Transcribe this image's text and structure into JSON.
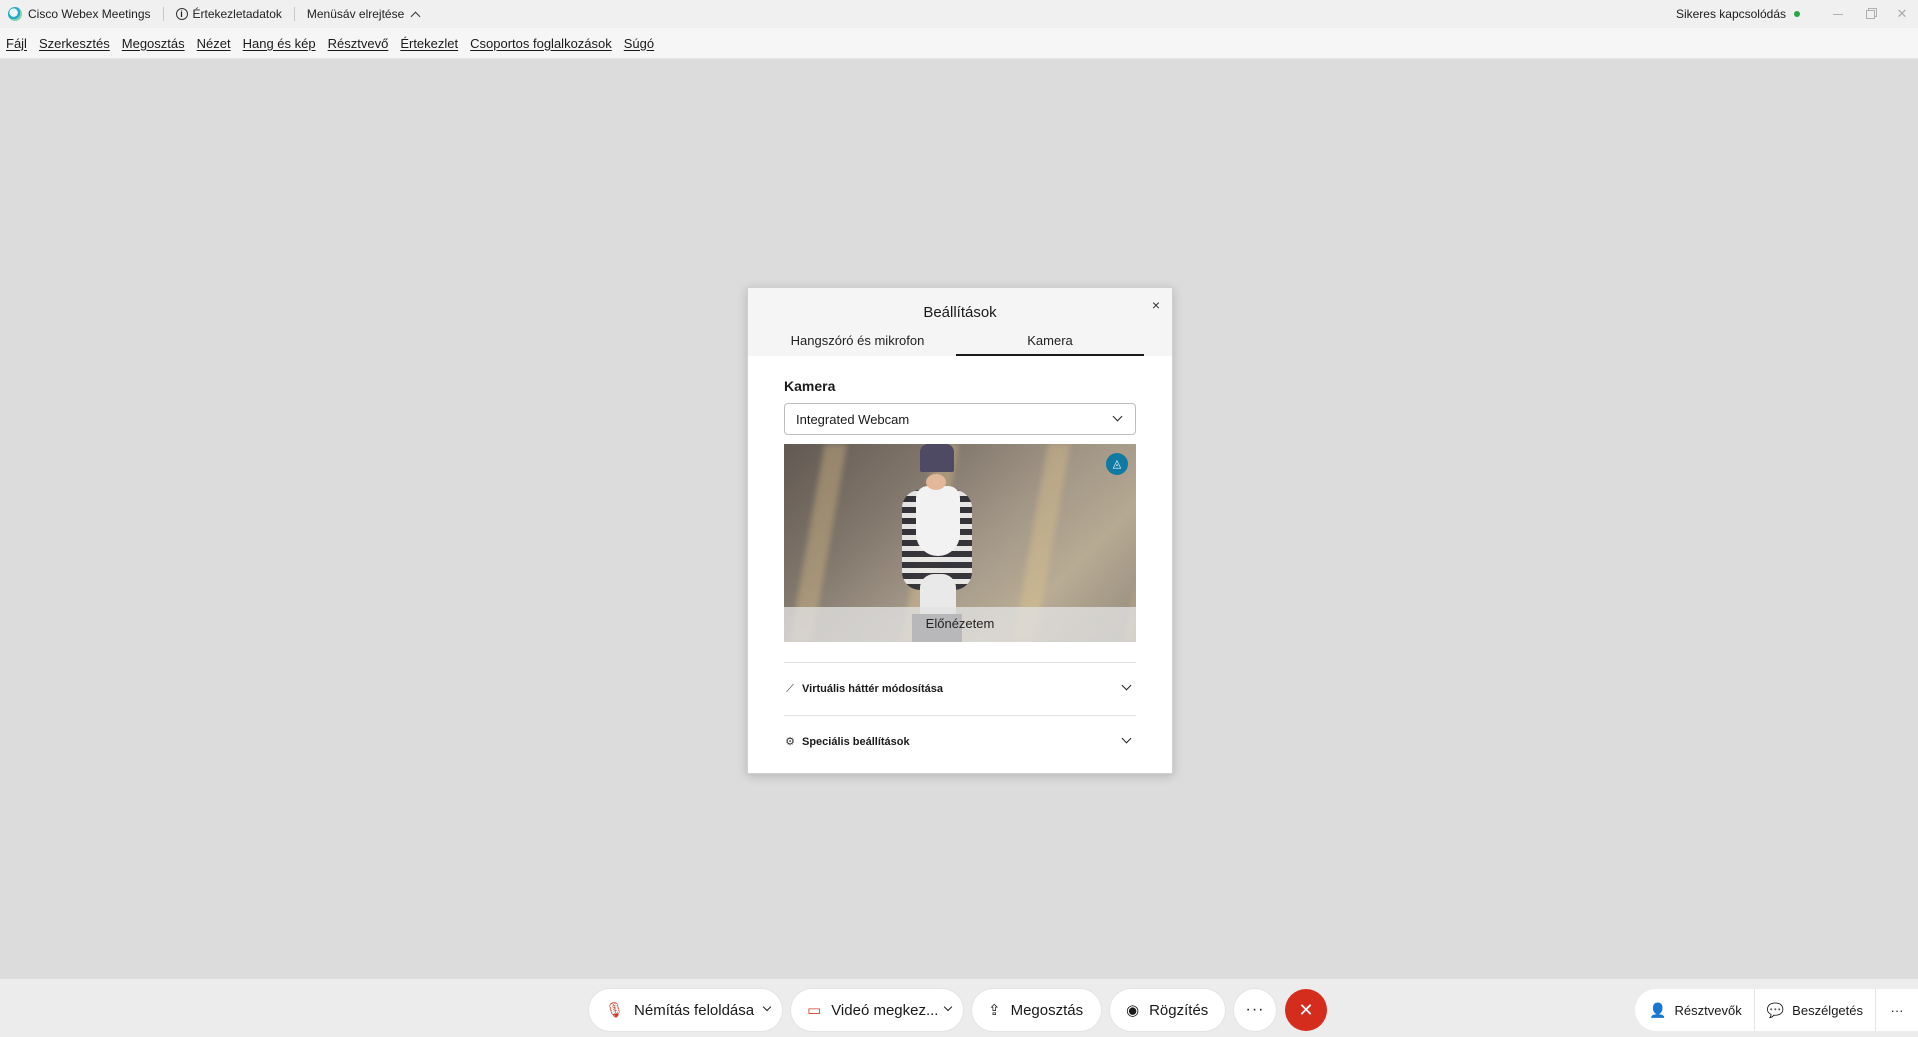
{
  "titlebar": {
    "app_name": "Cisco Webex Meetings",
    "meeting_info": "Értekezletadatok",
    "hide_menu": "Menüsáv elrejtése",
    "connection_status": "Sikeres kapcsolódás",
    "status_color": "#27a844"
  },
  "menu": {
    "items": [
      "Fájl",
      "Szerkesztés",
      "Megosztás",
      "Nézet",
      "Hang és kép",
      "Résztvevő",
      "Értekezlet",
      "Csoportos foglalkozások",
      "Súgó"
    ]
  },
  "dialog": {
    "title": "Beállítások",
    "close": "×",
    "tabs": [
      "Hangszóró és mikrofon",
      "Kamera"
    ],
    "active_tab": "Kamera",
    "camera_label": "Kamera",
    "camera_device": "Integrated Webcam",
    "preview_caption": "Előnézetem",
    "virtual_bg": "Virtuális háttér módosítása",
    "advanced": "Speciális beállítások"
  },
  "toolbar": {
    "unmute": "Némítás feloldása",
    "stop_video": "Videó megkez...",
    "share": "Megosztás",
    "record": "Rögzítés",
    "more": "···",
    "end": "✕",
    "participants": "Résztvevők",
    "chat": "Beszélgetés",
    "more_right": "···",
    "end_color": "#d42c1d",
    "muted_color": "#d23c2b"
  }
}
